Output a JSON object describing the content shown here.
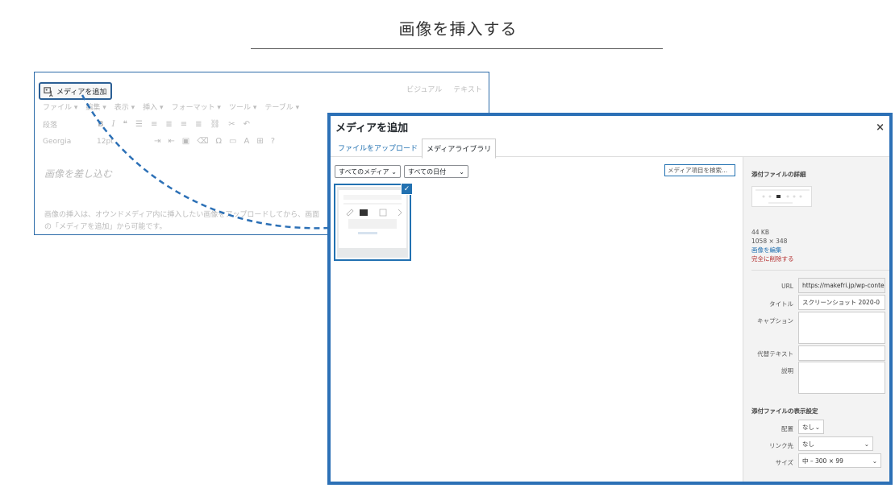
{
  "page_title": "画像を挿入する",
  "editor": {
    "add_media_label": "メディアを追加",
    "tabs": [
      "ビジュアル",
      "テキスト"
    ],
    "menu": [
      "ファイル ▾",
      "編集 ▾",
      "表示 ▾",
      "挿入 ▾",
      "フォーマット ▾",
      "ツール ▾",
      "テーブル ▾"
    ],
    "format_select": "段落",
    "font_select": "Georgia",
    "size_select": "12pt",
    "heading": "画像を差し込む",
    "body": "画像の挿入は、オウンドメディア内に挿入したい画像をアップロードしてから、画面の「メディアを追加」から可能です。"
  },
  "modal": {
    "title": "メディアを追加",
    "close": "×",
    "tabs": [
      "ファイルをアップロード",
      "メディアライブラリ"
    ],
    "filter_media": "すべてのメディア",
    "filter_date": "すべての日付",
    "search_placeholder": "メディア項目を検索..."
  },
  "details": {
    "heading": "添付ファイルの詳細",
    "filesize": "44 KB",
    "dimensions": "1058 × 348",
    "edit_link": "画像を編集",
    "delete_link": "完全に削除する",
    "url_label": "URL",
    "url_value": "https://makefri.jp/wp-conte",
    "title_label": "タイトル",
    "title_value": "スクリーンショット 2020-0",
    "caption_label": "キャプション",
    "alt_label": "代替テキスト",
    "description_label": "説明"
  },
  "display_settings": {
    "heading": "添付ファイルの表示設定",
    "align_label": "配置",
    "align_value": "なし",
    "link_label": "リンク先",
    "link_value": "なし",
    "size_label": "サイズ",
    "size_value": "中 – 300 × 99"
  },
  "colors": {
    "accent": "#2271b1",
    "modal_border": "#2c70b6",
    "danger": "#b32d2e"
  }
}
